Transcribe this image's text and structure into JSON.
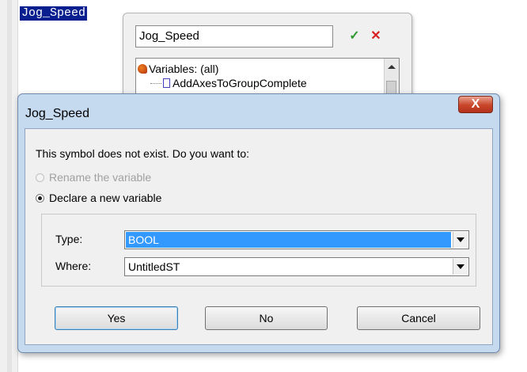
{
  "editor": {
    "selected_text": "Jog_Speed"
  },
  "popup": {
    "input_value": "Jog_Speed",
    "ok_glyph": "✓",
    "cancel_glyph": "✕",
    "tree": {
      "root_label": "Variables: (all)",
      "child_label": "AddAxesToGroupComplete"
    }
  },
  "dialog": {
    "title": "Jog_Speed",
    "close_glyph": "X",
    "message": "This symbol does not exist. Do you want to:",
    "options": [
      {
        "label": "Rename the variable",
        "enabled": false,
        "checked": false
      },
      {
        "label": "Declare a new variable",
        "enabled": true,
        "checked": true
      }
    ],
    "type_label": "Type:",
    "type_value": "BOOL",
    "where_label": "Where:",
    "where_value": "UntitledST",
    "buttons": {
      "yes": "Yes",
      "no": "No",
      "cancel": "Cancel"
    }
  },
  "colors": {
    "selection": "#0a1f8f",
    "dialog_frame": "#c5d9ef",
    "close_button": "#c9452a",
    "combo_highlight": "#3399ff"
  }
}
